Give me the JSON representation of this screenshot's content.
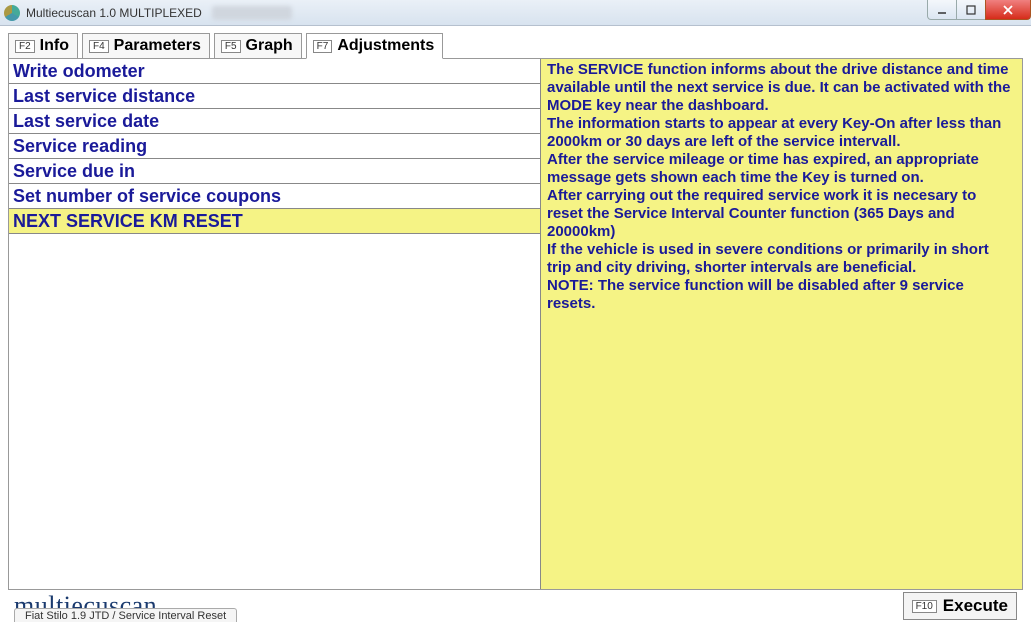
{
  "window": {
    "title": "Multiecuscan 1.0 MULTIPLEXED"
  },
  "tabs": [
    {
      "key": "F2",
      "label": "Info",
      "active": false
    },
    {
      "key": "F4",
      "label": "Parameters",
      "active": false
    },
    {
      "key": "F5",
      "label": "Graph",
      "active": false
    },
    {
      "key": "F7",
      "label": "Adjustments",
      "active": true
    }
  ],
  "adjustments": [
    {
      "label": "Write odometer",
      "selected": false
    },
    {
      "label": "Last service distance",
      "selected": false
    },
    {
      "label": "Last service date",
      "selected": false
    },
    {
      "label": "Service reading",
      "selected": false
    },
    {
      "label": "Service due in",
      "selected": false
    },
    {
      "label": "Set number of service coupons",
      "selected": false
    },
    {
      "label": "NEXT SERVICE KM RESET",
      "selected": true
    }
  ],
  "description": "The SERVICE function informs about the drive distance and time available until the next service is due. It can be activated with the MODE key near the dashboard.\nThe information starts to appear at every Key-On after less than 2000km or 30 days are left of the service intervall.\nAfter the service mileage or time has expired, an appropriate message gets shown each time the Key is turned on.\nAfter carrying out the required service work it is necesary to reset the Service Interval Counter function (365 Days and 20000km)\nIf the vehicle is used in severe conditions or primarily in short trip and city driving, shorter intervals are beneficial.\nNOTE: The service function will be disabled after 9 service resets.",
  "brand": "multiecuscan",
  "execute": {
    "key": "F10",
    "label": "Execute"
  },
  "status": "Fiat Stilo 1.9 JTD / Service Interval Reset"
}
